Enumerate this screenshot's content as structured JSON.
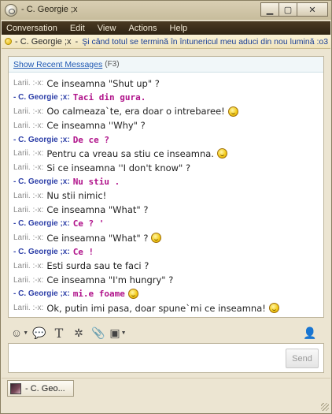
{
  "window": {
    "title": "- C. Georgie ;x"
  },
  "menu": [
    "Conversation",
    "Edit",
    "View",
    "Actions",
    "Help"
  ],
  "status": {
    "name": "- C. Georgie ;x",
    "separator": "-",
    "message": "Şi când totul se termină în întunericul meu aduci din nou lumină :o3 ."
  },
  "history": {
    "link": "Show Recent Messages",
    "shortcut": "(F3)"
  },
  "messages": [
    {
      "sender": "Larii. :-x:",
      "text": "Ce inseamna \"Shut up\" ?",
      "me": false,
      "emoji": false
    },
    {
      "sender": "- C. Georgie ;x:",
      "text": "Taci din gura.",
      "me": true,
      "emoji": false
    },
    {
      "sender": "Larii. :-x:",
      "text": "Oo calmeaza`te, era doar o intrebaree!",
      "me": false,
      "emoji": true
    },
    {
      "sender": "Larii. :-x:",
      "text": "Ce inseamna ''Why\" ?",
      "me": false,
      "emoji": false
    },
    {
      "sender": "- C. Georgie ;x:",
      "text": "De ce ?",
      "me": true,
      "emoji": false
    },
    {
      "sender": "Larii. :-x:",
      "text": "Pentru ca vreau sa stiu ce inseamna.",
      "me": false,
      "emoji": true
    },
    {
      "sender": "Larii. :-x:",
      "text": "Si ce inseamna ''I don't know\" ?",
      "me": false,
      "emoji": false
    },
    {
      "sender": "- C. Georgie ;x:",
      "text": "Nu stiu .",
      "me": true,
      "emoji": false
    },
    {
      "sender": "Larii. :-x:",
      "text": "Nu stii nimic!",
      "me": false,
      "emoji": false
    },
    {
      "sender": "Larii. :-x:",
      "text": "Ce inseamna \"What\" ?",
      "me": false,
      "emoji": false
    },
    {
      "sender": "- C. Georgie ;x:",
      "text": "Ce ? '",
      "me": true,
      "emoji": false
    },
    {
      "sender": "Larii. :-x:",
      "text": "Ce inseamna \"What\" ?",
      "me": false,
      "emoji": true
    },
    {
      "sender": "- C. Georgie ;x:",
      "text": "Ce !",
      "me": true,
      "emoji": false
    },
    {
      "sender": "Larii. :-x:",
      "text": "Esti surda sau te faci ?",
      "me": false,
      "emoji": false
    },
    {
      "sender": "Larii. :-x:",
      "text": "Ce inseamna \"I'm hungry\" ?",
      "me": false,
      "emoji": false
    },
    {
      "sender": "- C. Georgie ;x:",
      "text": "mi.e foame",
      "me": true,
      "emoji": true
    },
    {
      "sender": "Larii. :-x:",
      "text": "Ok, putin imi pasa, doar spune`mi ce inseamna!",
      "me": false,
      "emoji": true
    }
  ],
  "toolbar": {
    "icons": [
      "smiley-icon",
      "nudge-icon",
      "font-icon",
      "wink-icon",
      "attach-icon",
      "screenshot-icon"
    ],
    "right_icon": "contact-icon"
  },
  "input": {
    "value": "",
    "send_label": "Send"
  },
  "tab": {
    "label": "- C. Geo..."
  },
  "colors": {
    "menu_bg": "#3a2c18",
    "my_text": "#b0128a",
    "my_name": "#2d3fa8",
    "status_msg": "#1a3f97"
  }
}
